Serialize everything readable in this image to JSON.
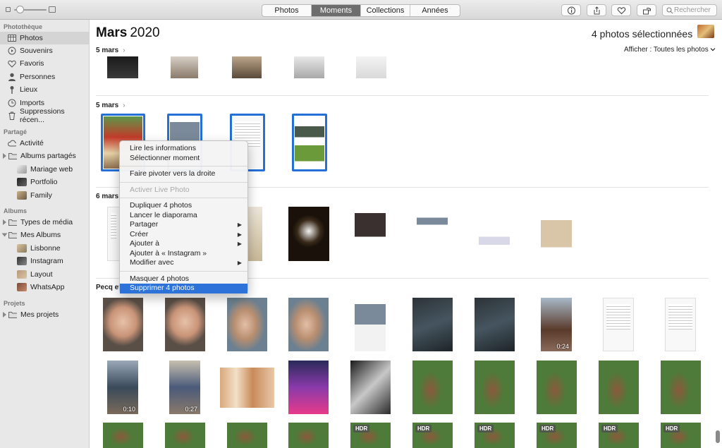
{
  "toolbar": {
    "tabs": [
      {
        "label": "Photos",
        "active": false
      },
      {
        "label": "Moments",
        "active": true
      },
      {
        "label": "Collections",
        "active": false
      },
      {
        "label": "Années",
        "active": false
      }
    ],
    "buttons": [
      "info-icon",
      "share-icon",
      "heart-icon",
      "rotate-icon"
    ],
    "search_placeholder": "Rechercher"
  },
  "sidebar": {
    "sections": [
      {
        "title": "Photothèque",
        "items": [
          {
            "label": "Photos",
            "icon": "photos-icon",
            "selected": true
          },
          {
            "label": "Souvenirs",
            "icon": "memories-icon"
          },
          {
            "label": "Favoris",
            "icon": "heart-icon"
          },
          {
            "label": "Personnes",
            "icon": "person-icon"
          },
          {
            "label": "Lieux",
            "icon": "pin-icon"
          },
          {
            "label": "Imports",
            "icon": "clock-icon"
          },
          {
            "label": "Suppressions récen...",
            "icon": "trash-icon"
          }
        ]
      },
      {
        "title": "Partagé",
        "items": [
          {
            "label": "Activité",
            "icon": "cloud-icon"
          },
          {
            "label": "Albums partagés",
            "icon": "folder-icon",
            "expandable": true
          },
          {
            "label": "Mariage web",
            "icon": "album-thumb",
            "child": true
          },
          {
            "label": "Portfolio",
            "icon": "album-thumb",
            "child": true
          },
          {
            "label": "Family",
            "icon": "album-thumb",
            "child": true
          }
        ]
      },
      {
        "title": "Albums",
        "items": [
          {
            "label": "Types de média",
            "icon": "folder-icon",
            "expandable": true
          },
          {
            "label": "Mes Albums",
            "icon": "folder-icon",
            "expandable": true,
            "expanded": true
          },
          {
            "label": "Lisbonne",
            "icon": "album-thumb",
            "child": true
          },
          {
            "label": "Instagram",
            "icon": "album-thumb",
            "child": true
          },
          {
            "label": "Layout",
            "icon": "album-thumb",
            "child": true
          },
          {
            "label": "WhatsApp",
            "icon": "album-thumb",
            "child": true
          }
        ]
      },
      {
        "title": "Projets",
        "items": [
          {
            "label": "Mes projets",
            "icon": "folder-icon",
            "expandable": true
          }
        ]
      }
    ]
  },
  "main": {
    "month": "Mars",
    "year": "2020",
    "selection_count": "4 photos sélectionnées",
    "show_filter": "Afficher : Toutes les photos",
    "moments": [
      {
        "label": "5 mars"
      },
      {
        "label": "5 mars"
      },
      {
        "label": "6 mars"
      },
      {
        "label": "Pecq et"
      }
    ],
    "durations": [
      "0:24",
      "0:10",
      "0:27"
    ],
    "badge": "HDR"
  },
  "context_menu": {
    "groups": [
      [
        {
          "label": "Lire les informations"
        },
        {
          "label": "Sélectionner moment"
        }
      ],
      [
        {
          "label": "Faire pivoter vers la droite"
        }
      ],
      [
        {
          "label": "Activer Live Photo",
          "disabled": true
        }
      ],
      [
        {
          "label": "Dupliquer 4 photos"
        },
        {
          "label": "Lancer le diaporama"
        },
        {
          "label": "Partager",
          "submenu": true
        },
        {
          "label": "Créer",
          "submenu": true
        },
        {
          "label": "Ajouter à",
          "submenu": true
        },
        {
          "label": "Ajouter à « Instagram »"
        },
        {
          "label": "Modifier avec",
          "submenu": true
        }
      ],
      [
        {
          "label": "Masquer 4 photos"
        },
        {
          "label": "Supprimer 4 photos",
          "highlighted": true
        }
      ]
    ]
  },
  "colors": {
    "accent": "#2d72d9",
    "selection_border": "#2470d6"
  }
}
